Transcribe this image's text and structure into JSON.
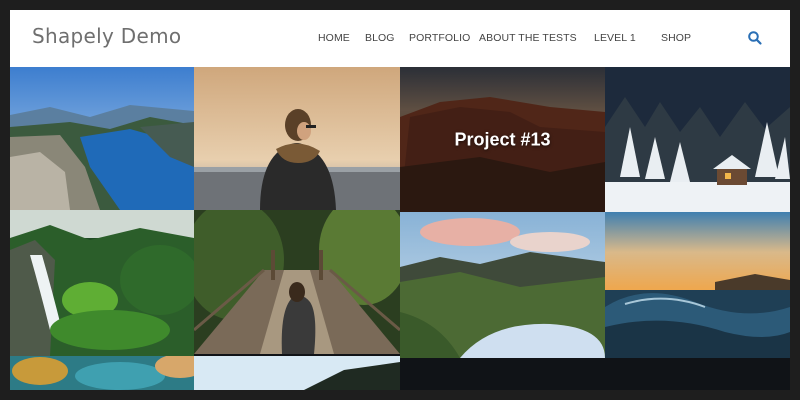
{
  "site": {
    "title": "Shapely Demo"
  },
  "nav": {
    "items": [
      {
        "label": "HOME"
      },
      {
        "label": "BLOG"
      },
      {
        "label": "PORTFOLIO"
      },
      {
        "label": "ABOUT THE TESTS"
      },
      {
        "label": "LEVEL 1"
      },
      {
        "label": "SHOP"
      }
    ],
    "search_icon": "search-icon"
  },
  "portfolio": {
    "hover_label": "Project #13",
    "tiles": [
      {
        "name": "fjord-landscape"
      },
      {
        "name": "person-at-sunset"
      },
      {
        "name": "canyon-sunset"
      },
      {
        "name": "snowy-cabin"
      },
      {
        "name": "waterfall-forest"
      },
      {
        "name": "forest-suspension-bridge"
      },
      {
        "name": "lake-mountains"
      },
      {
        "name": "ocean-wave-sunset"
      },
      {
        "name": "abstract-paint"
      },
      {
        "name": "sky-treeline"
      }
    ]
  },
  "colors": {
    "accent": "#2a6fb5",
    "nav_text": "#444444",
    "title_text": "#6f6f6f"
  }
}
